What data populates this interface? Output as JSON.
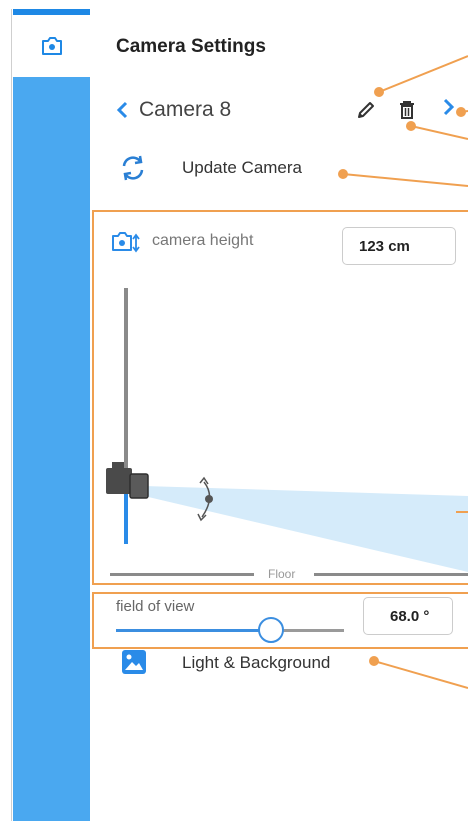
{
  "app": {
    "title": "Camera Settings",
    "icon": "camera-icon"
  },
  "nav": {
    "camera_name": "Camera 8",
    "back_icon": "chevron-left-icon",
    "edit_icon": "pencil-icon",
    "delete_icon": "trash-icon",
    "next_icon": "chevron-right-icon"
  },
  "update": {
    "label": "Update Camera",
    "icon": "refresh-icon"
  },
  "camera_height": {
    "label": "camera height",
    "value": "123 cm",
    "icon": "camera-height-icon",
    "floor_label": "Floor"
  },
  "field_of_view": {
    "label": "field of view",
    "value": "68.0 °",
    "slider_fraction": 0.68
  },
  "light": {
    "label": "Light & Background",
    "icon": "image-icon"
  },
  "colors": {
    "accent": "#3b8ee0",
    "rail": "#4aa8f0",
    "callout": "#f0a050",
    "cone": "#d5ebfa"
  }
}
